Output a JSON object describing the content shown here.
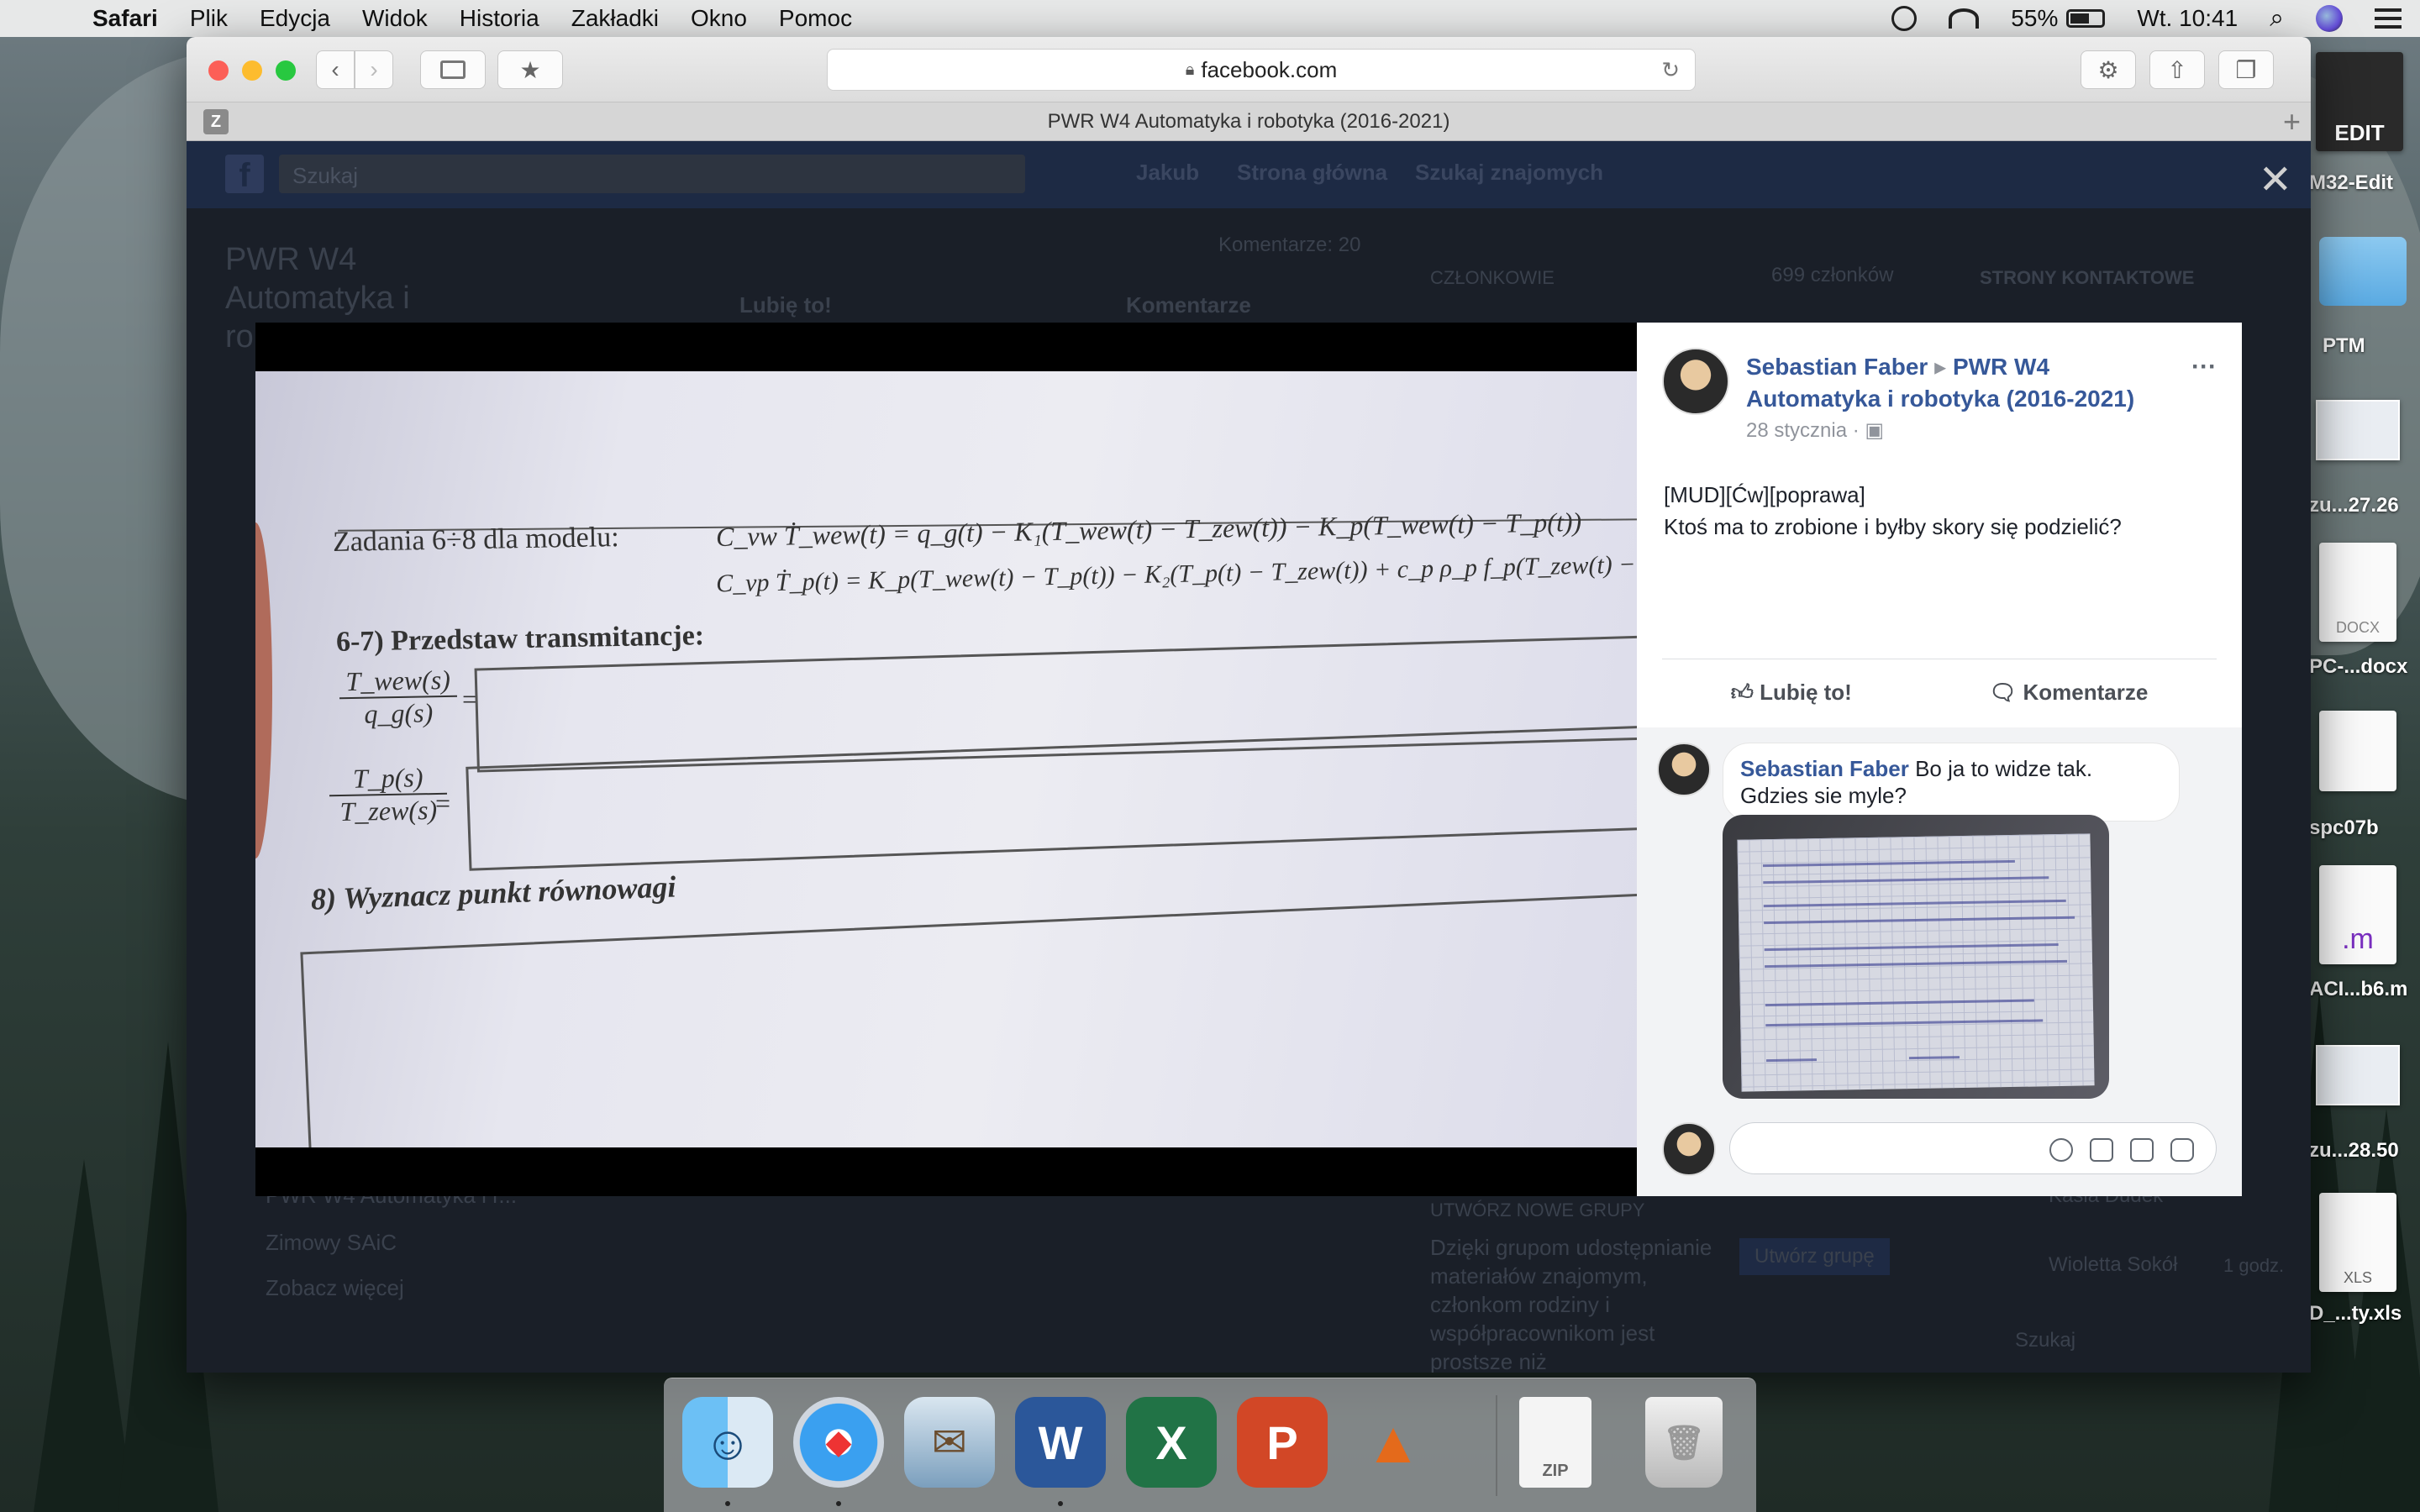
{
  "menubar": {
    "app": "Safari",
    "items": [
      "Plik",
      "Edycja",
      "Widok",
      "Historia",
      "Zakładki",
      "Okno",
      "Pomoc"
    ],
    "battery": "55%",
    "clock": "Wt. 10:41"
  },
  "browser": {
    "url": "facebook.com",
    "tab_title": "PWR W4 Automatyka i robotyka (2016-2021)",
    "tab_favicon_letter": "Z"
  },
  "fb_background": {
    "search_placeholder": "Szukaj",
    "nav": [
      "Jakub",
      "Strona główna",
      "Szukaj znajomych"
    ],
    "group_title": "PWR W4 Automatyka i ro",
    "comments_count": "Komentarze: 20",
    "like": "Lubię to!",
    "comment": "Komentarze",
    "members_label": "CZŁONKOWIE",
    "members_count": "699 członków",
    "contacts_label": "STRONY KONTAKTOWE",
    "sidebar_group": "PWR W4 Automatyka i r...",
    "sidebar_winter": "Zimowy SAiC",
    "sidebar_more": "Zobacz więcej",
    "new_group": "UTWÓRZ NOWE GRUPY",
    "new_group_text": "Dzięki grupom udostępnianie materiałów znajomym, członkom rodziny i współpracownikom jest prostsze niż",
    "create_group": "Utwórz grupę",
    "contact1": "Kasia Dudek",
    "contact2": "Wioletta Sokół",
    "contact2_time": "1 godz.",
    "chat_search": "Szukaj"
  },
  "photo": {
    "task_heading": "Zadania 6÷8 dla modelu:",
    "eq1": "C_vw Ṫ_wew(t) = q_g(t) − K₁(T_wew(t) − T_zew(t)) − K_p(T_wew(t) − T_p(t))",
    "eq2": "C_vp Ṫ_p(t) = K_p(T_wew(t) − T_p(t)) − K₂(T_p(t) − T_zew(t)) + c_p ρ_p f_p(T_zew(t) − T_p(t))",
    "q67": "6-7) Przedstaw transmitancje:",
    "frac1_num": "T_wew(s)",
    "frac1_den": "q_g(s)",
    "frac2_num": "T_p(s)",
    "frac2_den": "T_zew(s)",
    "q8": "8) Wyznacz punkt równowagi"
  },
  "post": {
    "author": "Sebastian Faber",
    "arrow": "▸",
    "group": "PWR W4 Automatyka i robotyka (2016-2021)",
    "date": "28 stycznia",
    "options": "···",
    "line1": "[MUD][Ćw][poprawa]",
    "line2": "Ktoś ma to zrobione i byłby skory się podzielić?",
    "like_label": "Lubię to!",
    "comment_label": "Komentarze"
  },
  "comment": {
    "author": "Sebastian Faber",
    "text": "Bo ja to widze tak. Gdzies sie myle?"
  },
  "desktop_icons": {
    "m32": "M32-Edit",
    "ptm": "PTM",
    "file1": "zu...27.26",
    "file2": "PC-...docx",
    "file3": "spc07b",
    "file4": "ACI...b6.m",
    "file5": "zu...28.50",
    "file6": "D_...ty.xls",
    "docx_tag": "DOCX",
    "m_tag": ".m",
    "xls_tag": "XLS",
    "m32_tag": "EDIT"
  },
  "dock": {
    "zip_tag": "ZIP"
  }
}
